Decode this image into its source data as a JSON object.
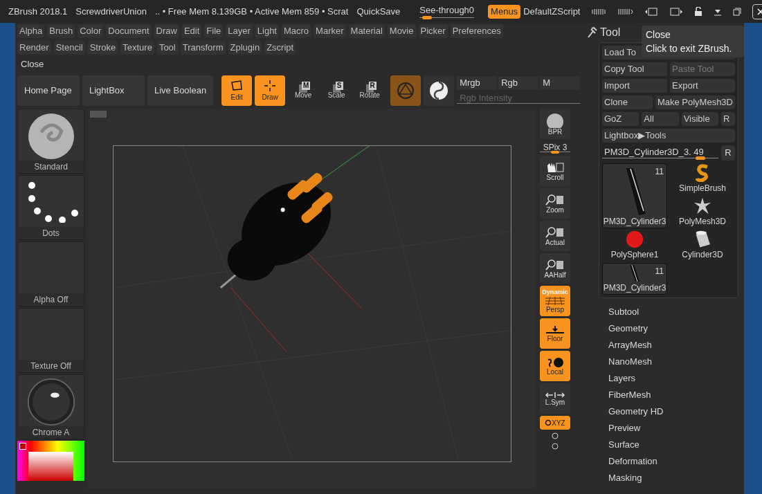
{
  "title_bar": {
    "app": "ZBrush 2018.1",
    "document": "ScrewdriverUnion",
    "memory": ".. • Free Mem 8.139GB • Active Mem 859 • Scrat",
    "quicksave": "QuickSave",
    "see_through": {
      "label": "See-through",
      "value": "0",
      "level": 0.05
    },
    "menus": {
      "label": "Menus",
      "on": true
    },
    "script": "DefaultZScript"
  },
  "menu_rows": [
    [
      "Alpha",
      "Brush",
      "Color",
      "Document",
      "Draw",
      "Edit",
      "File",
      "Layer",
      "Light",
      "Macro",
      "Marker",
      "Material",
      "Movie",
      "Picker",
      "Preferences"
    ],
    [
      "Render",
      "Stencil",
      "Stroke",
      "Texture",
      "Tool",
      "Transform",
      "Zplugin",
      "Zscript"
    ]
  ],
  "close_label": "Close",
  "toolbar": {
    "buttons": [
      "Home Page",
      "LightBox",
      "Live Boolean"
    ],
    "modes": [
      {
        "label": "Edit",
        "kind": "edit",
        "on": true
      },
      {
        "label": "Draw",
        "kind": "draw",
        "on": true
      },
      {
        "label": "Move",
        "kind": "move",
        "key": "M",
        "on": false
      },
      {
        "label": "Scale",
        "kind": "scale",
        "key": "S",
        "on": false
      },
      {
        "label": "Rotate",
        "kind": "rotate",
        "key": "R",
        "on": false
      }
    ],
    "color_fields": [
      "Mrgb",
      "Rgb",
      "M"
    ],
    "intensity": {
      "label": "Rgb Intensity",
      "level": 1
    }
  },
  "left_column": [
    {
      "label": "Standard",
      "kind": "brush"
    },
    {
      "label": "Dots",
      "kind": "stroke"
    },
    {
      "label": "Alpha Off",
      "kind": "empty"
    },
    {
      "label": "Texture Off",
      "kind": "empty"
    },
    {
      "label": "Chrome A",
      "kind": "material"
    }
  ],
  "shelf": {
    "spix": {
      "label": "SPix 3",
      "level": 0.5
    },
    "buttons": [
      {
        "label": "BPR",
        "kind": "bpr",
        "on": false
      },
      {
        "label": "Scroll",
        "kind": "scroll",
        "on": false
      },
      {
        "label": "Zoom",
        "kind": "zoom",
        "on": false
      },
      {
        "label": "Actual",
        "kind": "actual",
        "on": false
      },
      {
        "label": "AAHalf",
        "kind": "aahalf",
        "on": false
      },
      {
        "label": "Persp",
        "kind": "persp",
        "badge": "Dynamic",
        "on": true
      },
      {
        "label": "Floor",
        "kind": "floor",
        "on": true
      },
      {
        "label": "Local",
        "kind": "local",
        "on": true
      },
      {
        "label": "L.Sym",
        "kind": "lsym",
        "on": false
      },
      {
        "label": "XYZ",
        "kind": "xyz",
        "on": true
      }
    ]
  },
  "tool_panel": {
    "title": "Tool",
    "rows": [
      [
        {
          "label": "Load To",
          "disabled": false
        }
      ],
      [
        {
          "label": "Copy Tool",
          "disabled": false
        },
        {
          "label": "Paste Tool",
          "disabled": true
        }
      ],
      [
        {
          "label": "Import",
          "disabled": false
        },
        {
          "label": "Export",
          "disabled": false
        }
      ],
      [
        {
          "label": "Clone",
          "disabled": false
        },
        {
          "label": "Make PolyMesh3D",
          "disabled": false
        }
      ],
      [
        {
          "label": "GoZ",
          "disabled": false
        },
        {
          "label": "All",
          "disabled": false
        },
        {
          "label": "Visible",
          "disabled": false
        },
        {
          "label": "R",
          "disabled": false
        }
      ],
      [
        {
          "label": "Lightbox▶Tools",
          "disabled": false
        }
      ]
    ],
    "tool_slider": {
      "label": "PM3D_Cylinder3D_3. 49",
      "level": 0.9,
      "reset": "R"
    },
    "tools": [
      {
        "label": "PM3D_Cylinder3",
        "count": "11",
        "kind": "cylinder_stick",
        "selected": true
      },
      {
        "label": "SimpleBrush",
        "kind": "simplebrush",
        "selected": false
      },
      {
        "label": "PolyMesh3D",
        "kind": "star",
        "selected": false
      },
      {
        "label": "PolySphere1",
        "kind": "sphere",
        "selected": false
      },
      {
        "label": "Cylinder3D",
        "kind": "cylinder",
        "selected": false
      },
      {
        "label": "PM3D_Cylinder3",
        "count": "11",
        "kind": "cylinder_stick",
        "selected": true
      }
    ],
    "subpalettes": [
      "Subtool",
      "Geometry",
      "ArrayMesh",
      "NanoMesh",
      "Layers",
      "FiberMesh",
      "Geometry HD",
      "Preview",
      "Surface",
      "Deformation",
      "Masking"
    ]
  },
  "tooltip": {
    "title": "Close",
    "text": "Click to exit ZBrush."
  }
}
